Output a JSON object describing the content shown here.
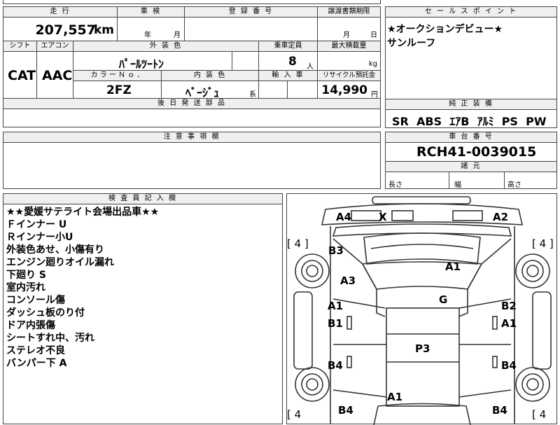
{
  "headers": {
    "mileage": "走 行",
    "inspection": "車 検",
    "registration": "登 録 番 号",
    "transfer_deadline": "譲渡書類期限",
    "sales_point": "セ ー ル ス ポ イ ン ト",
    "shift": "シフト",
    "aircon": "エアコン",
    "exterior_color": "外 装 色",
    "capacity": "乗車定員",
    "max_load": "最大積載量",
    "color_no": "カ ラ ー Ｎ ｏ ．",
    "interior_color": "内 装 色",
    "import_car": "輸 入 車",
    "recycle_fee": "リサイクル預託金",
    "deferred_parts": "後 日 発 送 部 品",
    "equipment": "純 正 装 備",
    "cautions": "注 意 事 項 欄",
    "chassis_no": "車 台 番 号",
    "dimensions": "諸 元",
    "inspector_notes": "検 査 員 記 入 欄"
  },
  "values": {
    "mileage": "207,557",
    "mileage_unit": "km",
    "insp_year_unit": "年",
    "insp_month_unit": "月",
    "transfer_month_unit": "月",
    "transfer_day_unit": "日",
    "shift": "CAT",
    "aircon": "AAC",
    "exterior_color": "ﾊﾟｰﾙﾂｰﾄﾝ",
    "capacity": "8",
    "capacity_unit": "人",
    "max_load_unit": "kg",
    "color_no": "2FZ",
    "interior_color": "ﾍﾞｰｼﾞｭ",
    "interior_suffix": "系",
    "recycle_fee": "14,990",
    "recycle_unit": "円",
    "equipment": "SR  ABS  ｴｱB  ｱﾙﾐ  PS  PW",
    "chassis_no": "RCH41-0039015",
    "length_label": "長さ",
    "width_label": "幅",
    "height_label": "高さ"
  },
  "sales_points": [
    "★オークションデビュー★",
    "サンルーフ"
  ],
  "inspector_notes": [
    "★★愛媛サテライト会場出品車★★",
    "Ｆインナー U",
    "Ｒインナー小U",
    "外装色あせ、小傷有り",
    "エンジン廻りオイル漏れ",
    "下廻り S",
    "室内汚れ",
    "コンソール傷",
    "ダッシュ板のり付",
    "ドア内張傷",
    "シートすれ中、汚れ",
    "ステレオ不良",
    "バンパー下 A"
  ],
  "diagram": {
    "tire_labels": [
      "[ 4 ]",
      "[ 4 ]",
      "[ 4",
      "[ 4"
    ],
    "marks": {
      "a4_top": "A4",
      "x_top": "X",
      "a2_top": "A2",
      "b3": "B3",
      "a1_hood": "A1",
      "a3": "A3",
      "g": "G",
      "a1_left": "A1",
      "b1_left": "B1",
      "b2_right": "B2",
      "a1_right": "A1",
      "p3": "P3",
      "b4_left": "B4",
      "b4_right": "B4",
      "a1_rear": "A1",
      "b4_bl": "B4",
      "b4_br": "B4"
    }
  }
}
